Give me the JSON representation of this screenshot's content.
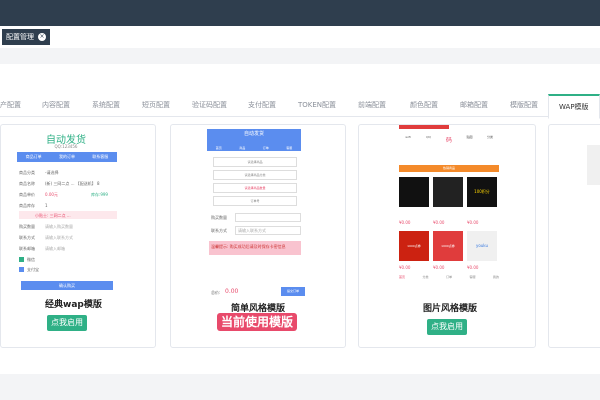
{
  "tabbar": {
    "tab_label": "配置管理",
    "close": "×"
  },
  "config_tabs": [
    "产配置",
    "内容配置",
    "系统配置",
    "短页配置",
    "验证码配置",
    "支付配置",
    "TOKEN配置",
    "前端配置",
    "颜色配置",
    "邮箱配置",
    "模版配置",
    "WAP模版"
  ],
  "active_tab": "WAP模版",
  "templates": {
    "classic": {
      "title": "自动发货",
      "sub": "QQ:123456",
      "tabs": [
        "商品订单",
        "我的订单",
        "联系客服"
      ],
      "rows": [
        [
          "商品分类",
          "-请选择"
        ],
        [
          "商品名称",
          "(新) 三网二点 ... 【配送机】 8"
        ],
        [
          "商品单价",
          "0.00元",
          "库存:999"
        ],
        [
          "商品库存",
          "1"
        ],
        [
          "",
          "小贴士: 三网二点 ..."
        ],
        [
          "购买数量",
          "请输入购买数量"
        ],
        [
          "联系方式",
          "请输入联系方式"
        ],
        [
          "联系邮箱",
          "请输入邮箱"
        ]
      ],
      "pay": [
        "微信",
        "支付宝"
      ],
      "submit": "确认购买",
      "caption": "经典wap模版",
      "button": "点我启用"
    },
    "simple": {
      "header": "自动发货",
      "icons": [
        "首页",
        "商品",
        "订单",
        "客服"
      ],
      "fields": [
        "请选择商品",
        "请选择商品分类",
        "请选择商品数量",
        "订单号"
      ],
      "qty_label": "购买数量",
      "contact_label": "联系方式",
      "contact_ph": "请输入联系方式",
      "notice": "温馨提示: 购买成功后请及时保存卡密信息",
      "total_label": "总价:",
      "total_value": "0.00",
      "buy": "提交订单",
      "caption": "简单风格模版",
      "badge": "当前使用模版"
    },
    "image": {
      "caption": "图片风格模版",
      "button": "点我启用",
      "icons": [
        "wifi",
        "QQ",
        "码",
        "贴图",
        "分类"
      ],
      "section": "热销商品",
      "prices": [
        "¥0.00",
        "¥0.00",
        "¥0.00",
        "¥0.00",
        "¥0.00",
        "¥0.00"
      ],
      "tiles": [
        "1000点券",
        "100积分",
        "1000点券",
        "youku"
      ],
      "nav": [
        "首页",
        "分类",
        "订单",
        "客服",
        "我的"
      ]
    }
  },
  "colors": {
    "accent": "#2fb086",
    "topbar": "#2f3e4e",
    "blue": "#5b8def",
    "pink": "#e84a6b"
  }
}
